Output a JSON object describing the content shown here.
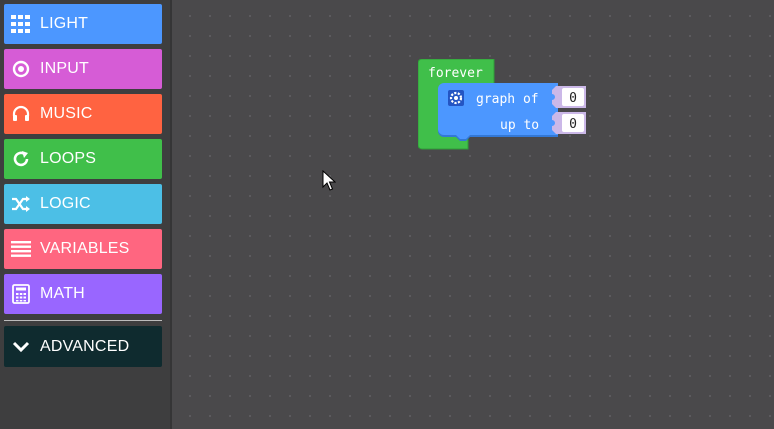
{
  "toolbox": {
    "categories": [
      {
        "label": "LIGHT",
        "color": "#4c97ff",
        "icon": "grid-icon"
      },
      {
        "label": "INPUT",
        "color": "#d65cd6",
        "icon": "radio-target-icon"
      },
      {
        "label": "MUSIC",
        "color": "#ff6341",
        "icon": "headphones-icon"
      },
      {
        "label": "LOOPS",
        "color": "#40bf4a",
        "icon": "refresh-icon"
      },
      {
        "label": "LOGIC",
        "color": "#4cbfe6",
        "icon": "shuffle-icon"
      },
      {
        "label": "VARIABLES",
        "color": "#ff6680",
        "icon": "list-lines-icon"
      },
      {
        "label": "MATH",
        "color": "#9966ff",
        "icon": "calculator-icon"
      }
    ],
    "advanced": {
      "label": "ADVANCED",
      "color": "#0f2b2f",
      "icon": "chevron-down-icon"
    }
  },
  "workspace": {
    "forever_block": {
      "label": "forever",
      "color": "#40bf4a",
      "inner_block": {
        "color": "#4c97ff",
        "line1_label": "graph of",
        "line1_value": "0",
        "line2_label": "up to",
        "line2_value": "0",
        "icon": "gear-icon"
      }
    }
  }
}
